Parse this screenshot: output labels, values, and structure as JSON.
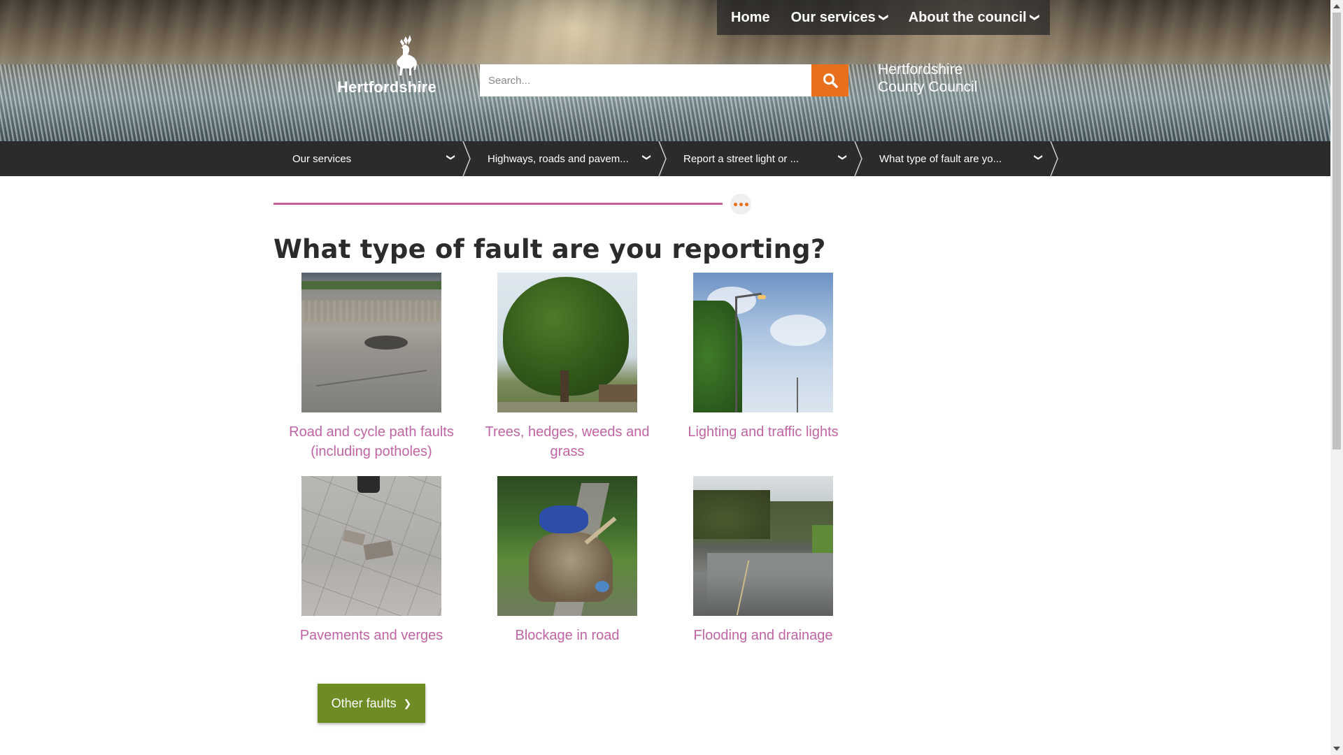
{
  "topnav": {
    "home": "Home",
    "services": "Our services",
    "about": "About the council"
  },
  "logo": {
    "text": "Hertfordshire"
  },
  "search": {
    "placeholder": "Search..."
  },
  "council": {
    "line1": "Hertfordshire",
    "line2": "County Council"
  },
  "breadcrumb": {
    "items": [
      {
        "label": "Our services"
      },
      {
        "label": "Highways, roads and pavem..."
      },
      {
        "label": "Report a street light or ..."
      },
      {
        "label": "What type of fault are yo..."
      }
    ]
  },
  "main": {
    "title": "What type of fault are you reporting?",
    "cards": [
      {
        "label": "Road and cycle path faults (including potholes)",
        "image": "pothole-road-photo"
      },
      {
        "label": "Trees, hedges, weeds and grass",
        "image": "tree-photo"
      },
      {
        "label": "Lighting and traffic lights",
        "image": "street-light-photo"
      },
      {
        "label": "Pavements and verges",
        "image": "broken-pavement-photo"
      },
      {
        "label": "Blockage in road",
        "image": "fly-tipping-photo"
      },
      {
        "label": "Flooding and drainage",
        "image": "flooded-road-photo"
      }
    ],
    "other_button": "Other faults"
  },
  "colors": {
    "accent_orange": "#e8701c",
    "link_pink": "#c064a4",
    "button_green": "#6e8c24",
    "breadcrumb_bg": "#2b2b2b"
  },
  "icons": {
    "search": "search-icon",
    "chevron": "chevron-down-icon",
    "more": "more-dots-icon",
    "stag": "stag-logo-icon"
  }
}
